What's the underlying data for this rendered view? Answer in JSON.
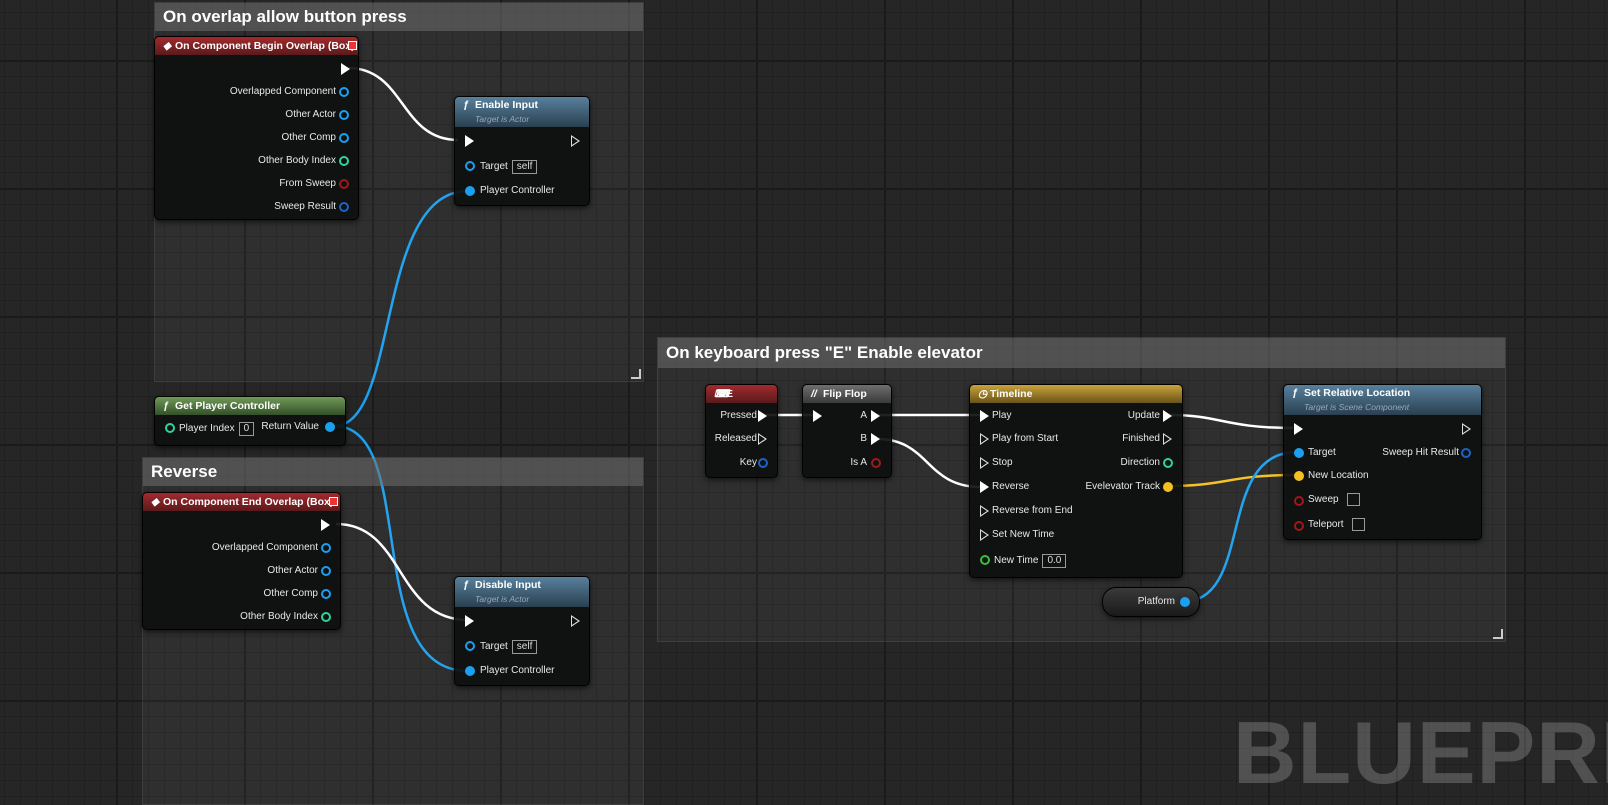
{
  "comments": {
    "overlap": "On overlap allow button press",
    "reverse": "Reverse",
    "keyboard": "On keyboard press \"E\" Enable elevator"
  },
  "begin_overlap": {
    "title": "On Component Begin Overlap (Box)",
    "pins": [
      "Overlapped Component",
      "Other Actor",
      "Other Comp",
      "Other Body Index",
      "From Sweep",
      "Sweep Result"
    ]
  },
  "enable_input": {
    "title": "Enable Input",
    "subtitle": "Target is Actor",
    "target_label": "Target",
    "target_value": "self",
    "player_controller": "Player Controller"
  },
  "get_player_controller": {
    "title": "Get Player Controller",
    "player_index_label": "Player Index",
    "player_index_value": "0",
    "return_value": "Return Value"
  },
  "end_overlap": {
    "title": "On Component End Overlap (Box)",
    "pins": [
      "Overlapped Component",
      "Other Actor",
      "Other Comp",
      "Other Body Index"
    ]
  },
  "disable_input": {
    "title": "Disable Input",
    "subtitle": "Target is Actor",
    "target_label": "Target",
    "target_value": "self",
    "player_controller": "Player Controller"
  },
  "key_e": {
    "title": "E",
    "pins": [
      "Pressed",
      "Released",
      "Key"
    ]
  },
  "flip_flop": {
    "title": "Flip Flop",
    "a": "A",
    "b": "B",
    "is_a": "Is A"
  },
  "timeline": {
    "title": "Timeline",
    "inputs": [
      "Play",
      "Play from Start",
      "Stop",
      "Reverse",
      "Reverse from End",
      "Set New Time"
    ],
    "new_time_label": "New Time",
    "new_time_value": "0.0",
    "outputs": [
      "Update",
      "Finished",
      "Direction",
      "Evelevator Track"
    ]
  },
  "set_relative_location": {
    "title": "Set Relative Location",
    "subtitle": "Target is Scene Component",
    "target": "Target",
    "sweep_hit_result": "Sweep Hit Result",
    "new_location": "New Location",
    "sweep": "Sweep",
    "teleport": "Teleport"
  },
  "platform": {
    "label": "Platform"
  },
  "watermark": "BLUEPRIN",
  "colors": {
    "exec_wire": "#ffffff",
    "object_pin": "#1ba0f0",
    "struct_pin": "#1a64c8",
    "int_pin": "#2ed3a0",
    "bool_pin": "#a01818",
    "vector_pin": "#f4c020",
    "float_pin": "#39c03a"
  }
}
